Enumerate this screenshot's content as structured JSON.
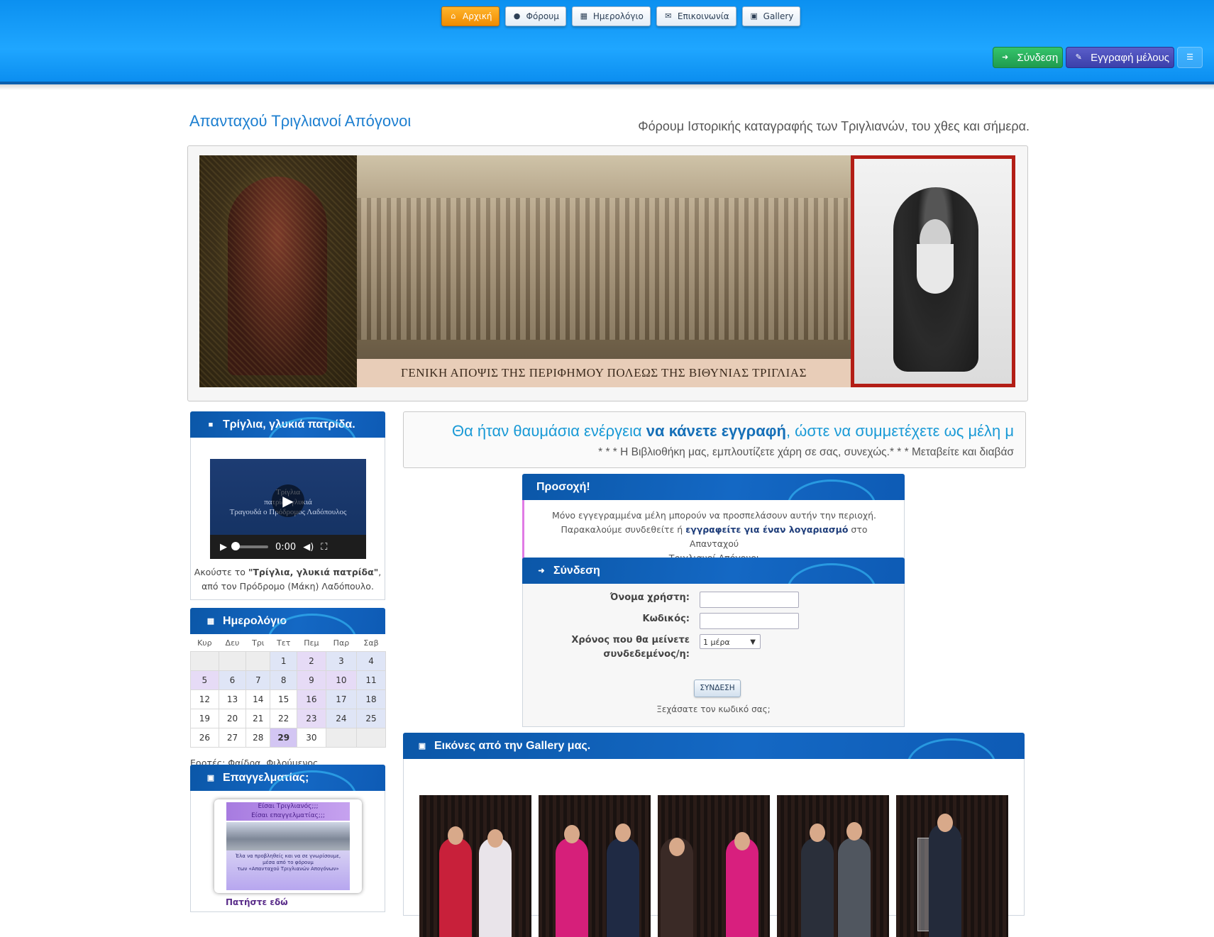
{
  "nav": {
    "items": [
      {
        "label": "Αρχική",
        "icon": "home-icon"
      },
      {
        "label": "Φόρουμ",
        "icon": "comments-icon"
      },
      {
        "label": "Ημερολόγιο",
        "icon": "calendar-icon"
      },
      {
        "label": "Επικοινωνία",
        "icon": "envelope-icon"
      },
      {
        "label": "Gallery",
        "icon": "image-icon"
      }
    ],
    "login_label": "Σύνδεση",
    "register_label": "Εγγραφή μέλους"
  },
  "site": {
    "title": "Απανταχού Τριγλιανοί Απόγονοι",
    "description": "Φόρουμ Ιστορικής καταγραφής των Τριγλιανών, του χθες και σήμερα."
  },
  "banner": {
    "caption": "ΓΕΝΙΚΗ ΑΠΟΨΙΣ ΤΗΣ ΠΕΡΙΦΗΜΟΥ ΠΟΛΕΩΣ ΤΗΣ ΒΙΘΥΝΙΑΣ ΤΡΙΓΛΙΑΣ"
  },
  "video_panel": {
    "title": "Τρίγλια, γλυκιά πατρίδα.",
    "video_title_line1": "Τρίγλια",
    "video_title_line2": "πατρίδα γλυκιά",
    "video_title_line3": "Τραγουδά ο Πρόδρομος Λαδόπουλος",
    "time": "0:00",
    "caption_prefix": "Ακούστε το ",
    "caption_song": "\"Τρίγλια, γλυκιά πατρίδα\"",
    "caption_suffix": ",",
    "caption_line2": "από τον Πρόδρομο (Μάκη) Λαδόπουλο."
  },
  "calendar_panel": {
    "title": "Ημερολόγιο",
    "weekdays": [
      "Κυρ",
      "Δευ",
      "Τρι",
      "Τετ",
      "Πεμ",
      "Παρ",
      "Σαβ"
    ],
    "weeks": [
      [
        "",
        "",
        "",
        "1",
        "2",
        "3",
        "4"
      ],
      [
        "5",
        "6",
        "7",
        "8",
        "9",
        "10",
        "11"
      ],
      [
        "12",
        "13",
        "14",
        "15",
        "16",
        "17",
        "18"
      ],
      [
        "19",
        "20",
        "21",
        "22",
        "23",
        "24",
        "25"
      ],
      [
        "26",
        "27",
        "28",
        "29",
        "30",
        "",
        ""
      ]
    ],
    "today": "29",
    "feasts": "Εορτές: Φαίδρα, Φιλούμενος"
  },
  "pro_panel": {
    "title": "Επαγγελματίας;",
    "ad_line1": "Είσαι Τριγλιανός;;;",
    "ad_line2": "Είσαι επαγγελματίας;;;",
    "ad_body1": "Έλα να προβληθείς και να σε γνωρίσουμε,",
    "ad_body2": "μέσα από το φόρουμ",
    "ad_body3": "των «Απανταχού Τριγλιανών Απογόνων»",
    "bottom_text": "Πατήστε εδώ"
  },
  "marquee": {
    "line1_before": "Θα ήταν θαυμάσια ενέργεια ",
    "line1_bold": "να κάνετε εγγραφή",
    "line1_after": ", ώστε να συμμετέχετε ως μέλη μ",
    "line2": "* * * Η Βιβλιοθήκη μας, εμπλουτίζετε χάρη σε σας, συνεχώς.* * * Μεταβείτε και διαβάσ"
  },
  "notice": {
    "title": "Προσοχή!",
    "line1": "Μόνο εγγεγραμμένα μέλη μπορούν να προσπελάσουν αυτήν την περιοχή.",
    "line2_before": "Παρακαλούμε συνδεθείτε ή ",
    "line2_link": "εγγραφείτε για έναν λογαριασμό",
    "line2_after": " στο Απανταχού",
    "line3": "Τριγλιανοί Απόγονοι"
  },
  "login": {
    "title": "Σύνδεση",
    "username_label": "Όνομα χρήστη:",
    "password_label": "Κωδικός:",
    "duration_label_1": "Χρόνος που θα μείνετε",
    "duration_label_2": "συνδεδεμένος/η:",
    "duration_value": "1 μέρα",
    "username_value": "",
    "password_value": "",
    "submit_label": "ΣΥΝΔΕΣΗ",
    "forgot_label": "Ξεχάσατε τον κωδικό σας;"
  },
  "gallery": {
    "title": "Εικόνες από την Gallery μας."
  },
  "colors": {
    "topbar": "#1fa6ff",
    "panel_header": "#1468c4",
    "active_nav": "#f08c00",
    "login_green": "#1f9b4f",
    "register_purple": "#3b3faa"
  }
}
